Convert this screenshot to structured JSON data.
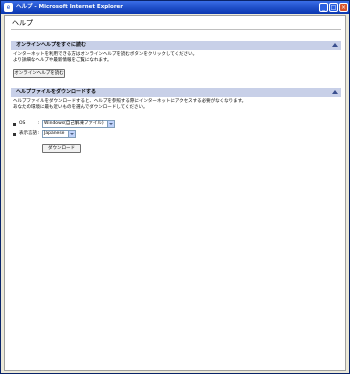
{
  "window": {
    "title": "ヘルプ - Microsoft Internet Explorer",
    "minimize": "_",
    "maximize": "□",
    "close": "×"
  },
  "page": {
    "title": "ヘルプ"
  },
  "online": {
    "header": "オンラインヘルプをすぐに読む",
    "desc1": "インターネットを利用できる方はオンラインヘルプを読むボタンをクリックしてください。",
    "desc2": "より詳細なヘルプや最新情報をご覧になれます。",
    "button": "オンラインヘルプを読む"
  },
  "download": {
    "header": "ヘルプファイルをダウンロードする",
    "desc1": "ヘルプファイルをダウンロードすると、ヘルプを参照する際にインターネットにアクセスする必要がなくなります。",
    "desc2": "あなたの環境に最も近いものを選んでダウンロードしてください。",
    "os_label": "OS",
    "os_value": "Windows(自己解凍ファイル)",
    "lang_label": "表示言語",
    "lang_value": "Japanese",
    "button": "ダウンロード"
  }
}
